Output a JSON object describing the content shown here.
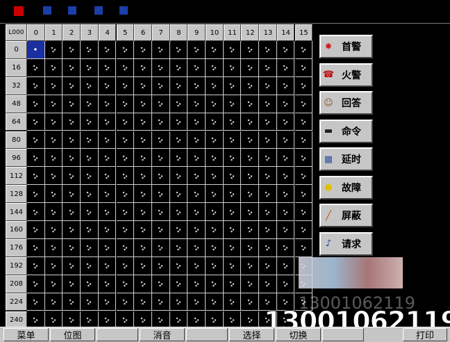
{
  "grid": {
    "corner_label": "L000",
    "column_headers": [
      "0",
      "1",
      "2",
      "3",
      "4",
      "5",
      "6",
      "7",
      "8",
      "9",
      "10",
      "11",
      "12",
      "13",
      "14",
      "15"
    ],
    "row_headers": [
      "0",
      "16",
      "32",
      "48",
      "64",
      "80",
      "96",
      "112",
      "128",
      "144",
      "160",
      "176",
      "192",
      "208",
      "224",
      "240"
    ]
  },
  "side_buttons": [
    {
      "label": "首警",
      "icon": "fire-alarm-icon"
    },
    {
      "label": "火警",
      "icon": "phone-icon"
    },
    {
      "label": "回答",
      "icon": "reply-icon"
    },
    {
      "label": "命令",
      "icon": "command-icon"
    },
    {
      "label": "延时",
      "icon": "calendar-icon"
    },
    {
      "label": "故障",
      "icon": "fault-bulb-icon"
    },
    {
      "label": "屏蔽",
      "icon": "shield-pen-icon"
    },
    {
      "label": "请求",
      "icon": "note-icon"
    }
  ],
  "bottom_bar": {
    "menu_label": "菜单",
    "map_label": "位图",
    "mute_label": "消音",
    "select_label": "选择",
    "switch_label": "切换",
    "print_label": "打印"
  },
  "watermark": {
    "phone": "13001062119"
  },
  "colors": {
    "selected_cell": "#1a2fa0",
    "button_face": "#c6c6c6"
  }
}
